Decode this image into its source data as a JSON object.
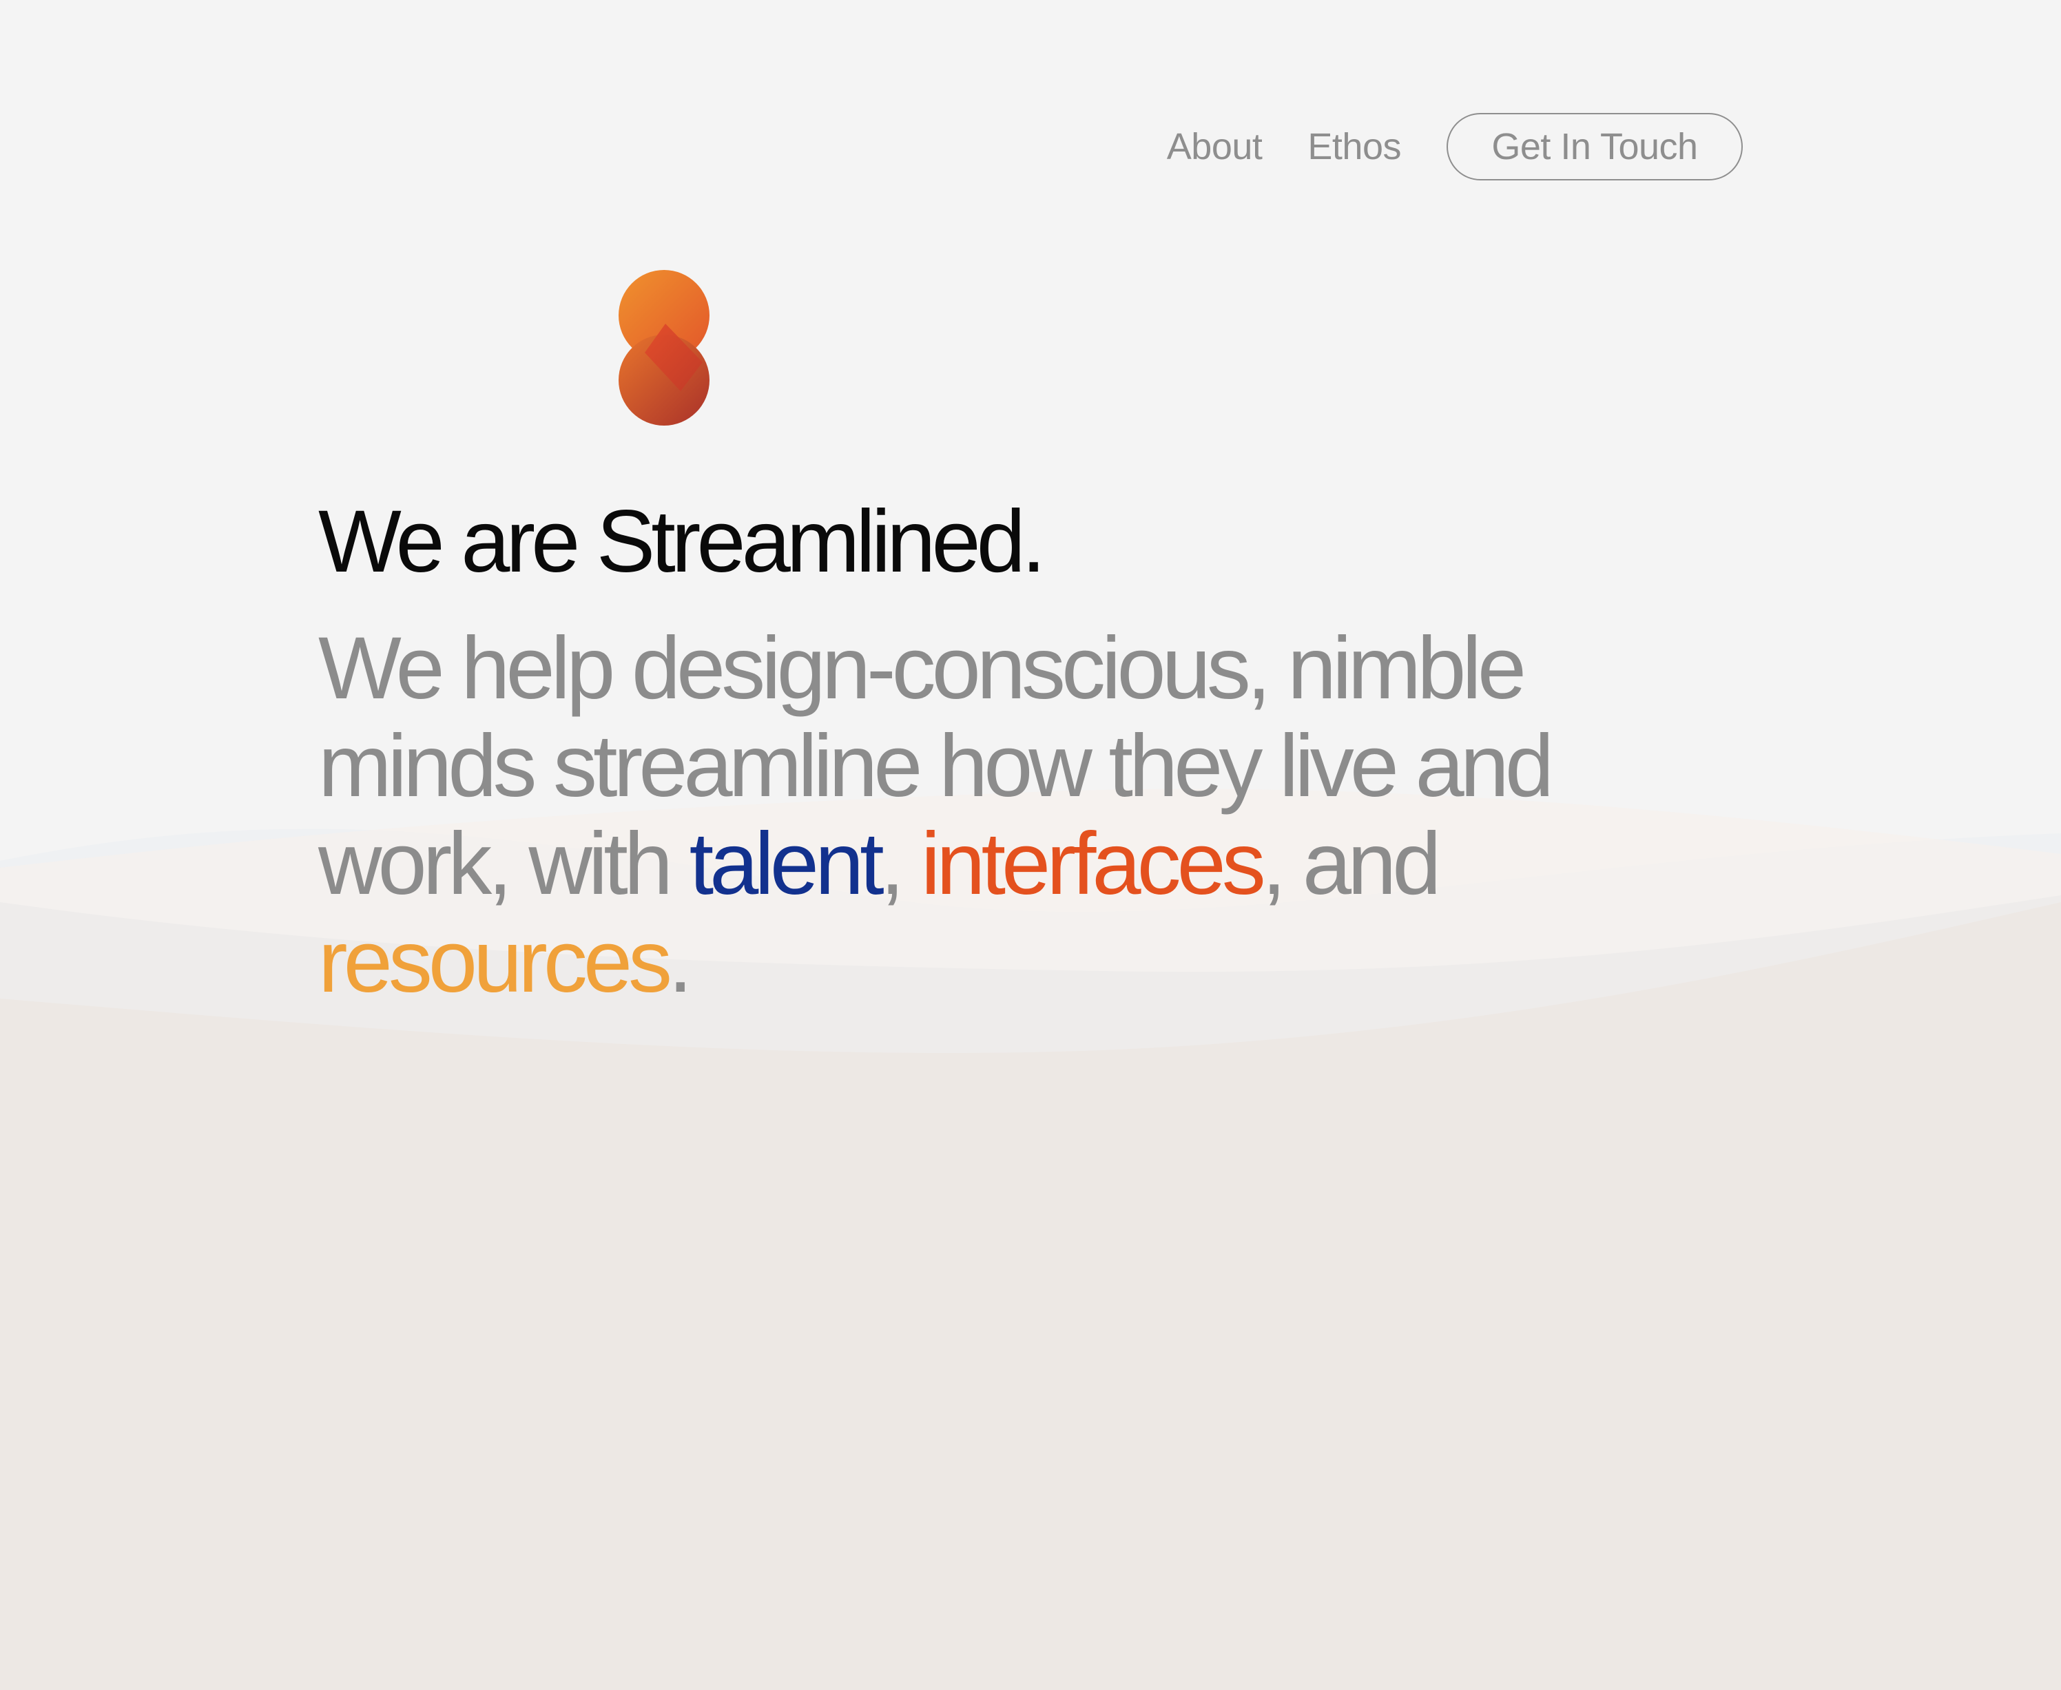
{
  "nav": {
    "about_label": "About",
    "ethos_label": "Ethos",
    "contact_label": "Get In Touch"
  },
  "hero": {
    "logo_icon": "streamlined-s-logo-icon",
    "headline": "We are Streamlined.",
    "description": {
      "intro": "We help design-conscious, nimble minds streamline how they live and work, with ",
      "talent": "talent",
      "comma1": ", ",
      "interfaces": "interfaces",
      "and_text": ", and ",
      "resources": "resources",
      "period": "."
    }
  },
  "colors": {
    "background": "#f4f4f4",
    "headline": "#0a0a0a",
    "body_text": "#8c8c8c",
    "talent": "#12318e",
    "interfaces": "#e4511e",
    "resources": "#f0a13a",
    "logo_light": "#f0922e",
    "logo_dark": "#b3352a"
  }
}
